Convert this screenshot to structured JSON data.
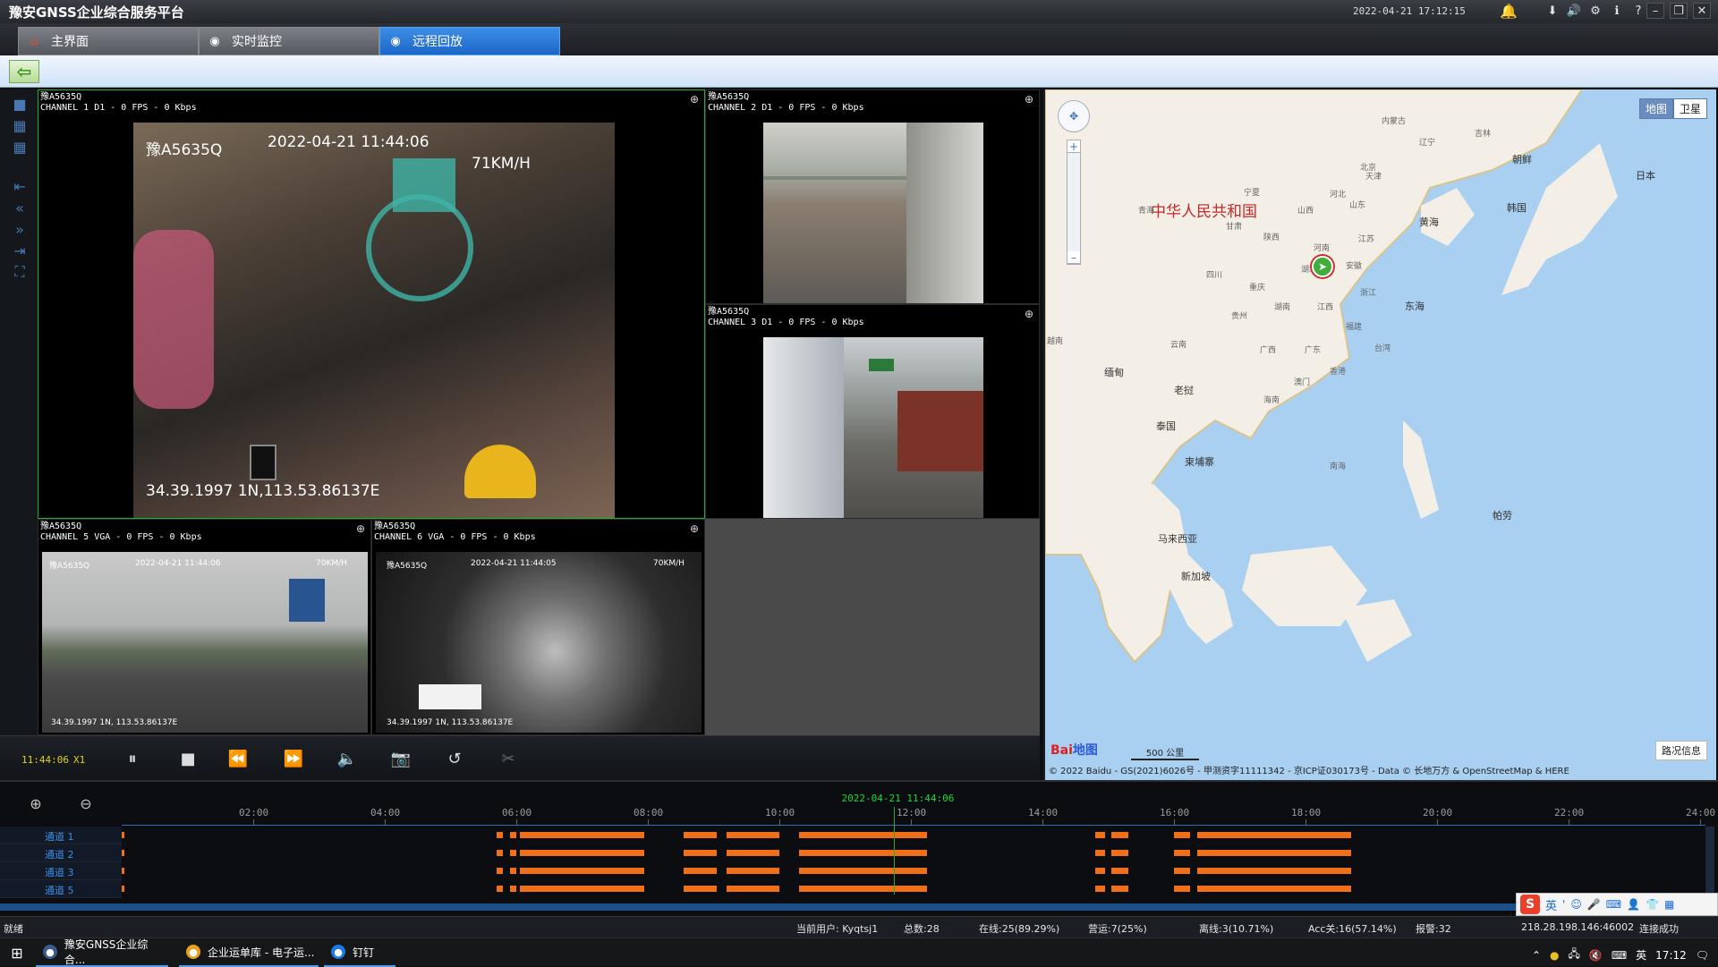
{
  "window": {
    "title": "豫安GNSS企业综合服务平台",
    "clock": "2022-04-21 17:12:15"
  },
  "tabs": [
    {
      "label": "主界面",
      "icon": "home-icon"
    },
    {
      "label": "实时监控",
      "icon": "monitor-icon"
    },
    {
      "label": "远程回放",
      "icon": "playback-icon"
    }
  ],
  "channels": [
    {
      "plate": "豫A5635Q",
      "info": "CHANNEL 1  D1 - 0 FPS - 0 Kbps",
      "overlay_plate": "豫A5635Q",
      "overlay_time": "2022-04-21 11:44:06",
      "overlay_speed": "71KM/H",
      "overlay_coords": "34.39.1997 1N,113.53.86137E"
    },
    {
      "plate": "豫A5635Q",
      "info": "CHANNEL 2  D1 - 0 FPS - 0 Kbps"
    },
    {
      "plate": "豫A5635Q",
      "info": "CHANNEL 3  D1 - 0 FPS - 0 Kbps"
    },
    {
      "plate": "豫A5635Q",
      "info": "CHANNEL 5  VGA - 0 FPS - 0 Kbps",
      "overlay_plate": "豫A5635Q",
      "overlay_time": "2022-04-21 11:44:06",
      "overlay_speed": "70KM/H",
      "overlay_coords": "34.39.1997 1N, 113.53.86137E"
    },
    {
      "plate": "豫A5635Q",
      "info": "CHANNEL 6  VGA - 0 FPS - 0 Kbps",
      "overlay_plate": "豫A5635Q",
      "overlay_time": "2022-04-21 11:44:05",
      "overlay_speed": "70KM/H",
      "overlay_coords": "34.39.1997 1N, 113.53.86137E"
    }
  ],
  "playback": {
    "time": "11:44:06",
    "speed": "X1"
  },
  "map": {
    "type_map": "地图",
    "type_satellite": "卫星",
    "country_label": "中华人民共和国",
    "labels": [
      "内蒙古",
      "吉林",
      "朝鲜",
      "日本",
      "韩国",
      "辽宁",
      "北京",
      "天津",
      "河北",
      "山西",
      "山东",
      "黄海",
      "宁夏",
      "甘肃",
      "青海",
      "陕西",
      "河南",
      "江苏",
      "安徽",
      "湖北",
      "四川",
      "重庆",
      "浙江",
      "东海",
      "贵州",
      "湖南",
      "江西",
      "福建",
      "台湾",
      "云南",
      "广西",
      "广东",
      "香港",
      "澳门",
      "海南",
      "缅甸",
      "老挝",
      "泰国",
      "柬埔寨",
      "南海",
      "帕劳",
      "马来西亚",
      "新加坡",
      "越南"
    ],
    "scale": "500 公里",
    "copyright": "© 2022 Baidu - GS(2021)6026号 - 甲测资字11111342 - 京ICP证030173号 - Data © 长地万方 & OpenStreetMap & HERE",
    "traffic": "路况信息",
    "logo_a": "Bai",
    "logo_b": "地图"
  },
  "timeline": {
    "cursor_label": "2022-04-21 11:44:06",
    "ticks": [
      "02:00",
      "04:00",
      "06:00",
      "08:00",
      "10:00",
      "12:00",
      "14:00",
      "16:00",
      "18:00",
      "20:00",
      "22:00",
      "24:00"
    ],
    "channels": [
      "通道 1",
      "通道 2",
      "通道 3",
      "通道 5"
    ],
    "segments_hours": [
      [
        5.7,
        5.8
      ],
      [
        5.9,
        6.0
      ],
      [
        6.05,
        7.95
      ],
      [
        8.55,
        9.05
      ],
      [
        9.2,
        10.0
      ],
      [
        10.3,
        12.25
      ],
      [
        14.8,
        14.95
      ],
      [
        15.05,
        15.3
      ],
      [
        16.0,
        16.25
      ],
      [
        16.35,
        18.7
      ]
    ],
    "cursor_hour": 11.735
  },
  "status": {
    "ready": "就绪",
    "user": "当前用户: Kyqtsj1",
    "total": "总数:28",
    "online": "在线:25(89.29%)",
    "operating": "营运:7(25%)",
    "offline": "离线:3(10.71%)",
    "acc_off": "Acc关:16(57.14%)",
    "alarm": "报警:32",
    "server": "218.28.198.146:46002",
    "connection": "连接成功"
  },
  "ime": {
    "lang": "英"
  },
  "taskbar": {
    "items": [
      "豫安GNSS企业综合...",
      "企业运单库 - 电子运...",
      "钉钉"
    ],
    "ime_lang": "英",
    "time": "17:12"
  }
}
